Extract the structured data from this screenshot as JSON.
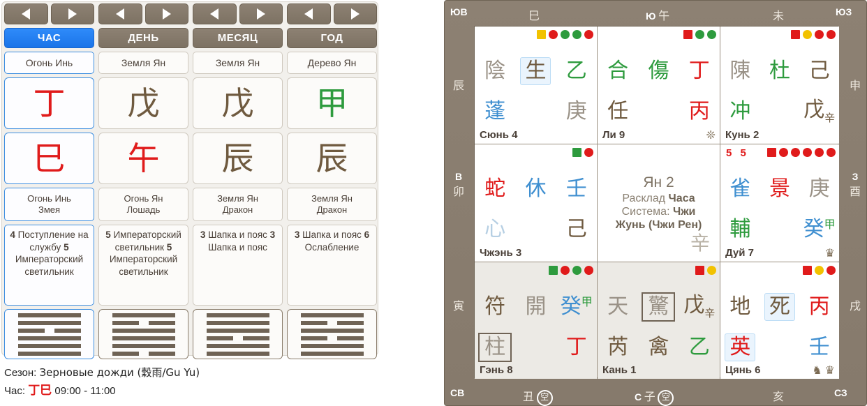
{
  "left": {
    "nav": {
      "prev_icon": "arrow-left-icon",
      "next_icon": "arrow-right-icon"
    },
    "pillars": [
      {
        "title": "ЧАС",
        "active": true,
        "element": "Огонь Инь",
        "stem": "丁",
        "stem_color": "#e01b1b",
        "branch": "巳",
        "branch_color": "#e01b1b",
        "desc1": "Огонь Инь",
        "desc2": "Змея",
        "stars": "4 Поступление на службу 5 Императорский светильник",
        "star_items": [
          {
            "num": "4",
            "name": "Поступле­ние на служ­бу"
          },
          {
            "num": "5",
            "name": "Император­ский светиль­ник"
          }
        ],
        "hexagram": [
          1,
          1,
          0,
          1,
          1,
          1
        ]
      },
      {
        "title": "ДЕНЬ",
        "active": false,
        "element": "Земля Ян",
        "stem": "戊",
        "stem_color": "#6f5a3f",
        "branch": "午",
        "branch_color": "#e01b1b",
        "desc1": "Огонь Ян",
        "desc2": "Лошадь",
        "star_items": [
          {
            "num": "5",
            "name": "Император­ский светиль­ник"
          },
          {
            "num": "5",
            "name": "Император­ский светиль­ник"
          }
        ],
        "hexagram": [
          1,
          0,
          1,
          1,
          1,
          0
        ]
      },
      {
        "title": "МЕСЯЦ",
        "active": false,
        "element": "Земля Ян",
        "stem": "戊",
        "stem_color": "#6f5a3f",
        "branch": "辰",
        "branch_color": "#6f5a3f",
        "desc1": "Земля Ян",
        "desc2": "Дракон",
        "star_items": [
          {
            "num": "3",
            "name": "Шапка и пояс"
          },
          {
            "num": "3",
            "name": "Шапка и пояс"
          }
        ],
        "hexagram": [
          1,
          1,
          1,
          0,
          1,
          1
        ]
      },
      {
        "title": "ГОД",
        "active": false,
        "element": "Дерево Ян",
        "stem": "甲",
        "stem_color": "#2e9b3e",
        "branch": "辰",
        "branch_color": "#6f5a3f",
        "desc1": "Земля Ян",
        "desc2": "Дракон",
        "star_items": [
          {
            "num": "3",
            "name": "Шапка и пояс"
          },
          {
            "num": "6",
            "name": "Ослабле­ние"
          }
        ],
        "hexagram": [
          1,
          0,
          1,
          0,
          1,
          1
        ]
      }
    ],
    "footer": {
      "season_label": "Сезон:",
      "season_value": "Зерновые дожди (穀雨/Gu Yu)",
      "hour_label": "Час:",
      "hour_glyph": "丁巳",
      "hour_range": "09:00 - 11:00"
    }
  },
  "right": {
    "edges": {
      "top_left_corner": "ЮВ",
      "top_right_corner": "ЮЗ",
      "bottom_left_corner": "СВ",
      "bottom_right_corner": "СЗ",
      "top": [
        {
          "branch": "巳",
          "dir": ""
        },
        {
          "branch": "午",
          "dir": "Ю"
        },
        {
          "branch": "未",
          "dir": ""
        }
      ],
      "left": [
        {
          "branch": "辰",
          "dir": ""
        },
        {
          "branch": "卯",
          "dir": "В"
        },
        {
          "branch": "寅",
          "dir": ""
        }
      ],
      "right": [
        {
          "branch": "申",
          "dir": ""
        },
        {
          "branch": "酉",
          "dir": "З"
        },
        {
          "branch": "戌",
          "dir": ""
        }
      ],
      "bottom": [
        {
          "branch": "丑",
          "dir": "",
          "empty": "空"
        },
        {
          "branch": "子",
          "dir": "С",
          "empty": "空"
        },
        {
          "branch": "亥",
          "dir": "",
          "empty": ""
        }
      ]
    },
    "center": {
      "line1": "Ян 2",
      "line2_plain": "Расклад ",
      "line2_bold": "Часа",
      "line3_plain": "Система: ",
      "line3_bold": "Чжи",
      "line4_bold": "Жунь (Чжи Рен)",
      "corner_char": "辛"
    },
    "cells": [
      {
        "name": "Сюнь 4",
        "shaded": false,
        "pair_numbers": "",
        "dots": [
          {
            "shape": "square",
            "color": "#f2c200"
          },
          {
            "shape": "circle",
            "color": "#e01b1b"
          },
          {
            "shape": "circle",
            "color": "#2e9b3e"
          },
          {
            "shape": "circle",
            "color": "#2e9b3e"
          },
          {
            "shape": "circle",
            "color": "#e01b1b"
          }
        ],
        "row1": [
          {
            "text": "陰",
            "color": "#9a9287",
            "style": "plain"
          },
          {
            "text": "生",
            "color": "#6f5a3f",
            "style": "highlight"
          },
          {
            "text": "乙",
            "color": "#2e9b3e",
            "style": "plain"
          }
        ],
        "row2": [
          {
            "text": "蓬",
            "color": "#3f8fd0",
            "style": "plain"
          },
          {
            "text": "",
            "color": "",
            "style": "plain"
          },
          {
            "text": "庚",
            "color": "#9a9287",
            "style": "plain"
          }
        ],
        "icons": []
      },
      {
        "name": "Ли 9",
        "shaded": false,
        "pair_numbers": "",
        "dots": [
          {
            "shape": "square",
            "color": "#e01b1b"
          },
          {
            "shape": "circle",
            "color": "#2e9b3e"
          },
          {
            "shape": "circle",
            "color": "#2e9b3e"
          }
        ],
        "row1": [
          {
            "text": "合",
            "color": "#2e9b3e",
            "style": "plain"
          },
          {
            "text": "傷",
            "color": "#2e9b3e",
            "style": "plain"
          },
          {
            "text": "丁",
            "color": "#e01b1b",
            "style": "plain"
          }
        ],
        "row2": [
          {
            "text": "任",
            "color": "#6f5a3f",
            "style": "plain"
          },
          {
            "text": "",
            "color": "",
            "style": "plain"
          },
          {
            "text": "丙",
            "color": "#e01b1b",
            "style": "plain"
          }
        ],
        "icons": [
          "flower-icon"
        ]
      },
      {
        "name": "Кунь 2",
        "shaded": false,
        "pair_numbers": "",
        "dots": [
          {
            "shape": "square",
            "color": "#e01b1b"
          },
          {
            "shape": "circle",
            "color": "#f2c200"
          },
          {
            "shape": "circle",
            "color": "#e01b1b"
          },
          {
            "shape": "circle",
            "color": "#e01b1b"
          }
        ],
        "row1": [
          {
            "text": "陳",
            "color": "#9a9287",
            "style": "plain"
          },
          {
            "text": "杜",
            "color": "#2e9b3e",
            "style": "plain"
          },
          {
            "text": "己",
            "color": "#6f5a3f",
            "style": "plain"
          }
        ],
        "row2": [
          {
            "text": "冲",
            "color": "#2e9b3e",
            "style": "plain"
          },
          {
            "text": "",
            "color": "",
            "style": "plain"
          },
          {
            "text": "戊",
            "color": "#6f5a3f",
            "style": "sub",
            "sub": "辛",
            "sub_color": "#6f5a3f"
          }
        ],
        "icons": []
      },
      {
        "name": "Чжэнь 3",
        "shaded": false,
        "pair_numbers": "",
        "dots": [
          {
            "shape": "square",
            "color": "#2e9b3e"
          },
          {
            "shape": "circle",
            "color": "#e01b1b"
          }
        ],
        "row1": [
          {
            "text": "蛇",
            "color": "#e01b1b",
            "style": "plain"
          },
          {
            "text": "休",
            "color": "#3f8fd0",
            "style": "plain"
          },
          {
            "text": "壬",
            "color": "#3f8fd0",
            "style": "plain"
          }
        ],
        "row2": [
          {
            "text": "心",
            "color": "#b6cfe3",
            "style": "plain"
          },
          {
            "text": "",
            "color": "",
            "style": "plain"
          },
          {
            "text": "己",
            "color": "#6f5a3f",
            "style": "plain"
          }
        ],
        "icons": []
      },
      {
        "name": "Дуй 7",
        "shaded": false,
        "pair_numbers": "5 5",
        "dots": [
          {
            "shape": "square",
            "color": "#e01b1b"
          },
          {
            "shape": "circle",
            "color": "#e01b1b"
          },
          {
            "shape": "circle",
            "color": "#e01b1b"
          },
          {
            "shape": "circle",
            "color": "#e01b1b"
          },
          {
            "shape": "circle",
            "color": "#e01b1b"
          },
          {
            "shape": "circle",
            "color": "#e01b1b"
          }
        ],
        "row1": [
          {
            "text": "雀",
            "color": "#3f8fd0",
            "style": "plain"
          },
          {
            "text": "景",
            "color": "#e01b1b",
            "style": "plain"
          },
          {
            "text": "庚",
            "color": "#9a9287",
            "style": "plain"
          }
        ],
        "row2": [
          {
            "text": "輔",
            "color": "#2e9b3e",
            "style": "plain"
          },
          {
            "text": "",
            "color": "",
            "style": "plain"
          },
          {
            "text": "癸",
            "color": "#3f8fd0",
            "style": "sup",
            "sup": "甲",
            "sup_color": "#2e9b3e"
          }
        ],
        "icons": [
          "crown-icon"
        ]
      },
      {
        "name": "Гэнь 8",
        "shaded": true,
        "pair_numbers": "",
        "dots": [
          {
            "shape": "square",
            "color": "#2e9b3e"
          },
          {
            "shape": "circle",
            "color": "#e01b1b"
          },
          {
            "shape": "circle",
            "color": "#2e9b3e"
          },
          {
            "shape": "circle",
            "color": "#e01b1b"
          }
        ],
        "row1": [
          {
            "text": "符",
            "color": "#6f5a3f",
            "style": "plain"
          },
          {
            "text": "開",
            "color": "#9a9287",
            "style": "plain"
          },
          {
            "text": "癸",
            "color": "#3f8fd0",
            "style": "sup",
            "sup": "甲",
            "sup_color": "#2e9b3e"
          }
        ],
        "row2": [
          {
            "text": "柱",
            "color": "#9a9287",
            "style": "boxed"
          },
          {
            "text": "",
            "color": "",
            "style": "plain"
          },
          {
            "text": "丁",
            "color": "#e01b1b",
            "style": "plain"
          }
        ],
        "icons": []
      },
      {
        "name": "Кань 1",
        "shaded": true,
        "pair_numbers": "",
        "dots": [
          {
            "shape": "square",
            "color": "#e01b1b"
          },
          {
            "shape": "circle",
            "color": "#f2c200"
          }
        ],
        "row1": [
          {
            "text": "天",
            "color": "#9a9287",
            "style": "plain"
          },
          {
            "text": "驚",
            "color": "#9a9287",
            "style": "boxed"
          },
          {
            "text": "戊",
            "color": "#6f5a3f",
            "style": "sub",
            "sub": "辛",
            "sub_color": "#6f5a3f"
          }
        ],
        "row2": [
          {
            "text": "芮",
            "color": "#6f5a3f",
            "style": "plain"
          },
          {
            "text": "禽",
            "color": "#6f5a3f",
            "style": "plain"
          },
          {
            "text": "乙",
            "color": "#2e9b3e",
            "style": "plain"
          }
        ],
        "icons": []
      },
      {
        "name": "Цянь 6",
        "shaded": false,
        "pair_numbers": "",
        "dots": [
          {
            "shape": "square",
            "color": "#e01b1b"
          },
          {
            "shape": "circle",
            "color": "#f2c200"
          },
          {
            "shape": "circle",
            "color": "#e01b1b"
          }
        ],
        "row1": [
          {
            "text": "地",
            "color": "#6f5a3f",
            "style": "plain"
          },
          {
            "text": "死",
            "color": "#6f5a3f",
            "style": "highlight"
          },
          {
            "text": "丙",
            "color": "#e01b1b",
            "style": "plain"
          }
        ],
        "row2": [
          {
            "text": "英",
            "color": "#e01b1b",
            "style": "highlight"
          },
          {
            "text": "",
            "color": "",
            "style": "plain"
          },
          {
            "text": "壬",
            "color": "#3f8fd0",
            "style": "plain"
          }
        ],
        "icons": [
          "horse-icon",
          "crown-icon"
        ]
      }
    ]
  }
}
